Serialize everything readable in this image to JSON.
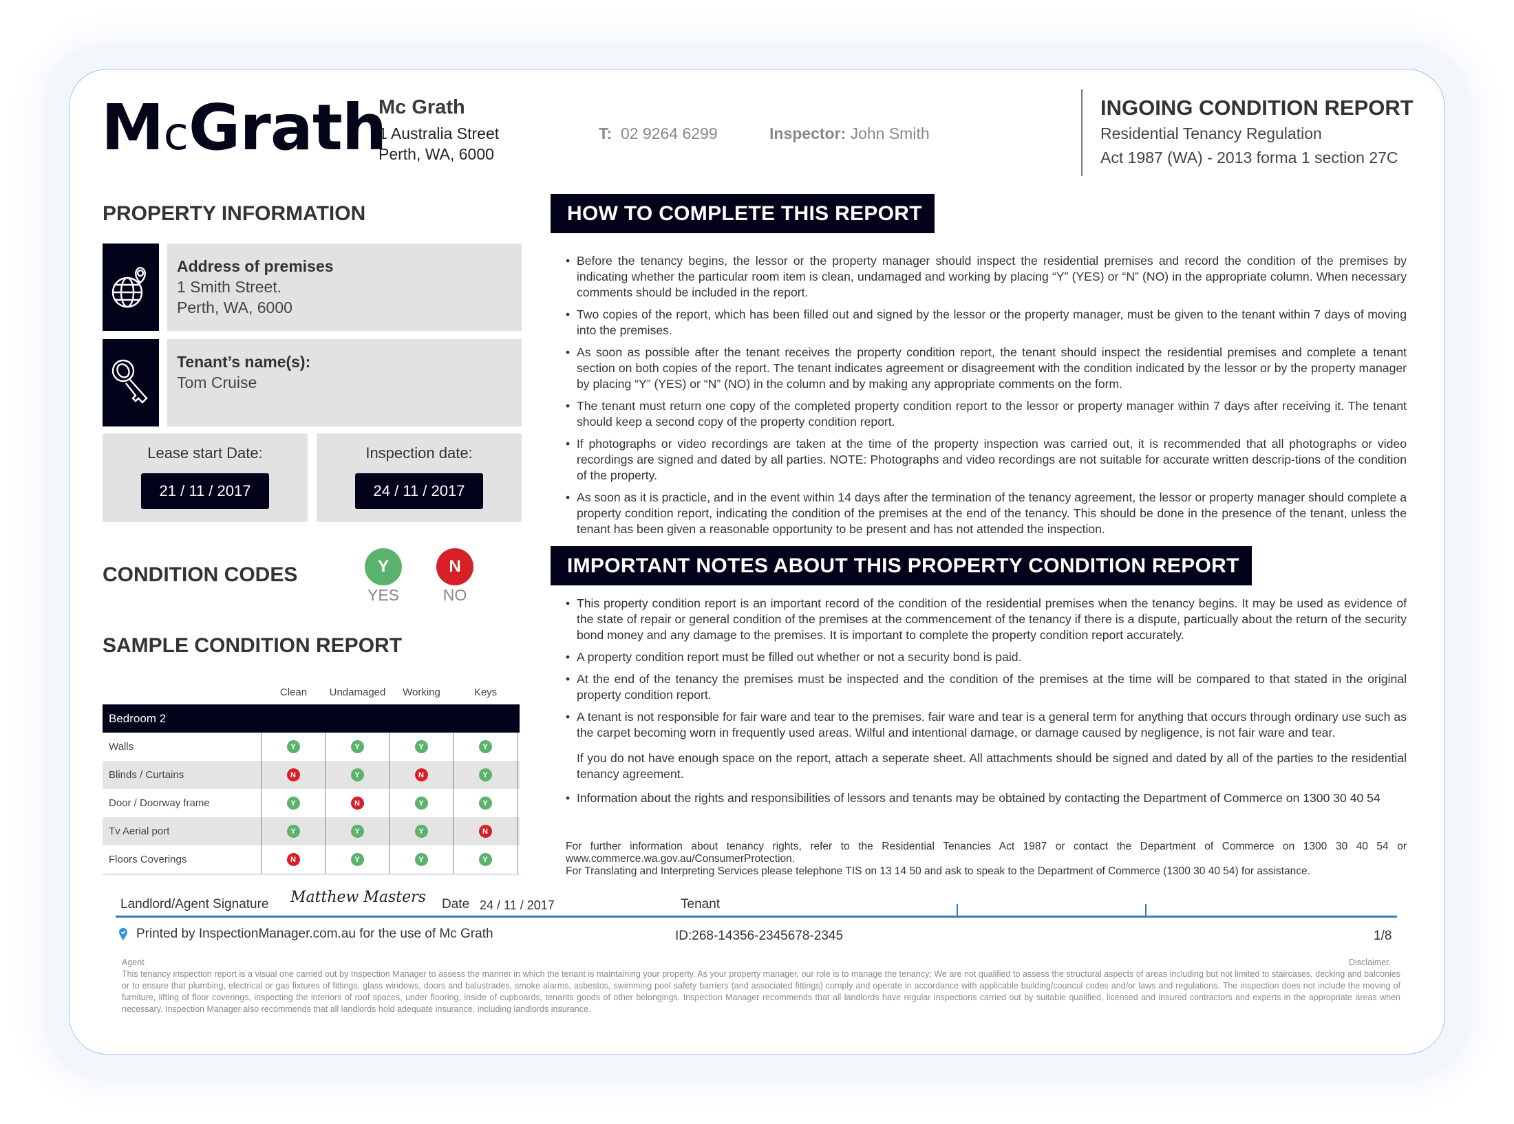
{
  "header": {
    "logo_m": "M",
    "logo_c": "c",
    "logo_rest": "Grath",
    "company_name": "Mc Grath",
    "company_address_line1": "1 Australia Street",
    "company_address_line2": "Perth, WA, 6000",
    "phone_label": "T:",
    "phone_value": "02 9264 6299",
    "inspector_label": "Inspector:",
    "inspector_value": "John Smith",
    "report_title": "INGOING CONDITION REPORT",
    "report_subtitle_line1": "Residential Tenancy Regulation",
    "report_subtitle_line2": "Act 1987 (WA) - 2013 forma 1 section 27C"
  },
  "property": {
    "heading": "PROPERTY INFORMATION",
    "address_label": "Address of premises",
    "address_line1": "1 Smith Street.",
    "address_line2": "Perth, WA, 6000",
    "tenant_label": "Tenant’s name(s):",
    "tenant_value": "Tom Cruise",
    "lease_start_label": "Lease start Date:",
    "lease_start_value": "21 / 11 / 2017",
    "inspection_label": "Inspection date:",
    "inspection_value": "24 / 11 / 2017",
    "globe_icon": "globe-pin-icon",
    "key_icon": "key-icon"
  },
  "condition_codes": {
    "heading": "CONDITION CODES",
    "yes_code": "Y",
    "yes_label": "YES",
    "no_code": "N",
    "no_label": "NO",
    "yes_color": "#5bb26c",
    "no_color": "#d62027"
  },
  "sample_report": {
    "heading": "SAMPLE CONDITION REPORT",
    "columns": [
      "Clean",
      "Undamaged",
      "Working",
      "Keys"
    ],
    "room": "Bedroom 2",
    "rows": [
      {
        "item": "Walls",
        "values": [
          "Y",
          "Y",
          "Y",
          "Y"
        ]
      },
      {
        "item": "Blinds / Curtains",
        "values": [
          "N",
          "Y",
          "N",
          "Y"
        ]
      },
      {
        "item": "Door / Doorway frame",
        "values": [
          "Y",
          "N",
          "Y",
          "Y"
        ]
      },
      {
        "item": "Tv Aerial port",
        "values": [
          "Y",
          "Y",
          "Y",
          "N"
        ]
      },
      {
        "item": "Floors Coverings",
        "values": [
          "N",
          "Y",
          "Y",
          "Y"
        ]
      }
    ]
  },
  "how_to": {
    "heading": "HOW TO COMPLETE THIS REPORT",
    "bullets": [
      "Before the tenancy begins, the lessor or the property manager should inspect the residential premises and record the condition of the premises by indicating whether the particular room item is clean, undamaged and working by placing “Y” (YES) or “N” (NO) in the appropriate column. When necessary comments should be included in the report.",
      "Two copies of the report, which has been filled out and signed by the lessor or the property manager, must be given to the tenant within 7 days of moving into the premises.",
      "As soon as possible after the tenant receives the property condition report, the tenant should inspect the residential premises and complete a tenant section on both copies of the report. The tenant indicates agreement or disagreement with the condition indicated by the lessor or by the property manager by placing “Y” (YES) or “N” (NO) in the column and by making any appropriate comments on the form.",
      "The tenant must return one copy of the completed property condition report to the lessor or property manager within 7 days after receiving it. The tenant should keep a second copy of the property condition report.",
      "If photographs or video recordings are taken at the time of the property inspection was carried out, it is recommended that all photographs or video recordings are signed and dated by all parties. NOTE: Photographs and video recordings are not suitable for accurate written descrip-tions of the condition of the property.",
      "As soon as it is practicle, and in the event within 14 days after the termination of the tenancy agreement, the lessor or property manager should complete a property condition report, indicating the condition of the premises at the end of the tenancy. This should be done in the presence of the tenant, unless the tenant has been given a reasonable opportunity to be present and has not attended the inspection."
    ]
  },
  "important_notes": {
    "heading": "IMPORTANT NOTES ABOUT THIS PROPERTY CONDITION REPORT",
    "bullets": [
      "This property condition report is an important record of the condition of the residential premises when the tenancy begins. It may be used as evidence of the state of repair or general condition of the premises at the commencement of the tenancy if there is a dispute, particually about the return of the security bond money and any damage to the premises. It is important to complete the property condition report accurately.",
      "A property condition report must be filled out whether or not a security bond is paid.",
      "At the end of the tenancy the premises must be inspected and the condition of the premises at the time will be compared to that stated in the original property condition report.",
      "A tenant is not responsible for fair ware and tear to the premises. fair ware and tear is a general term for anything that occurs through ordinary use such as the carpet becoming worn in frequently used areas. Wilful and intentional damage, or damage caused by negligence, is not fair ware and tear.",
      "If you do not have enough space on the report, attach a seperate sheet. All attachments should be signed and dated by all of the parties to the residential tenancy agreement.",
      "Information about the rights and responsibilities of lessors and tenants may be obtained by contacting the Department of Commerce on 1300 30 40 54"
    ],
    "footnote_line1": "For further information about tenancy rights, refer to the Residential Tenancies Act 1987 or contact the Department of Commerce on 1300 30 40 54 or www.commerce.wa.gov.au/ConsumerProtection.",
    "footnote_line2": "For Translating and Interpreting Services please telephone TIS on 13 14 50 and ask to speak to the Department of Commerce (1300 30 40 54) for assistance."
  },
  "signature": {
    "landlord_label": "Landlord/Agent Signature",
    "landlord_signature": "Matthew Masters",
    "date_label": "Date",
    "date_value": "24 / 11 / 2017",
    "tenant_label": "Tenant"
  },
  "footer": {
    "printed_by": "Printed by InspectionManager.com.au for the use of Mc Grath",
    "doc_id": "ID:268-14356-2345678-2345",
    "page": "1/8",
    "agent_label": "Agent",
    "disclaimer_label": "Disclaimer.",
    "disclaimer_text": "This tenancy inspection report is a visual one carried out by Inspection Manager to assess the manner in which the tenant is maintaining your property. As your property manager, our role is to manage the tenancy; We are not qualified to assess the structural aspects of areas including but not limited to staircases, decking and balconies or to ensure that plumbing, electrical or gas fixtures of fittings, glass windows, doors and balustrades, smoke alarms, asbestos, swimming pool safety barriers (and associated fittings) comply and operate in accordance with applicable building/councul codes and/or laws and regulations. The inspection does not include the moving of furniture, lifting of floor coverings, inspecting the interiors of roof spaces, under flooring, inside of cupboards, tenants goods of other belongings. Inspection Manager recommends that all landlords have regular inspections carried out by suitable qualified, licensed and insured contractors and experts in the appropriate areas when necessary. Inspection Manager also recommends that all landlords hold adequate insurance, including landlords insurance."
  }
}
